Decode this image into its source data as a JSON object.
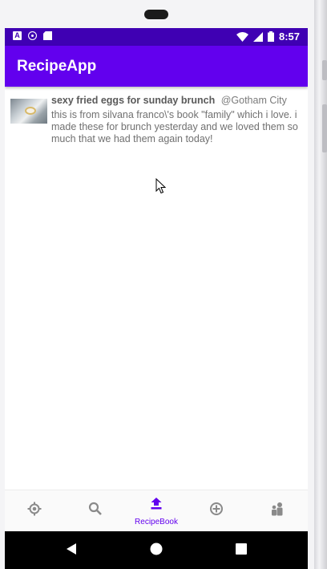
{
  "status_bar": {
    "time": "8:57",
    "icons": [
      "a-icon",
      "record-icon",
      "sd-card-icon",
      "wifi-icon",
      "signal-icon",
      "battery-icon"
    ]
  },
  "app_bar": {
    "title": "RecipeApp"
  },
  "recipes": [
    {
      "title": "sexy fried eggs for sunday brunch",
      "location": "@Gotham City",
      "description": "this is from silvana franco\\'s book \"family\" which i love. i made these for brunch yesterday and we loved them so much that we had them again today!"
    }
  ],
  "bottom_nav": {
    "items": [
      {
        "icon": "target-icon",
        "label": ""
      },
      {
        "icon": "search-icon",
        "label": ""
      },
      {
        "icon": "upload-icon",
        "label": "RecipeBook",
        "selected": true
      },
      {
        "icon": "add-circle-icon",
        "label": ""
      },
      {
        "icon": "people-icon",
        "label": ""
      }
    ],
    "active_color": "#6200ee",
    "inactive_color": "#8a8a8a"
  },
  "colors": {
    "status_bar": "#3f00b3",
    "app_bar": "#6200ee"
  }
}
